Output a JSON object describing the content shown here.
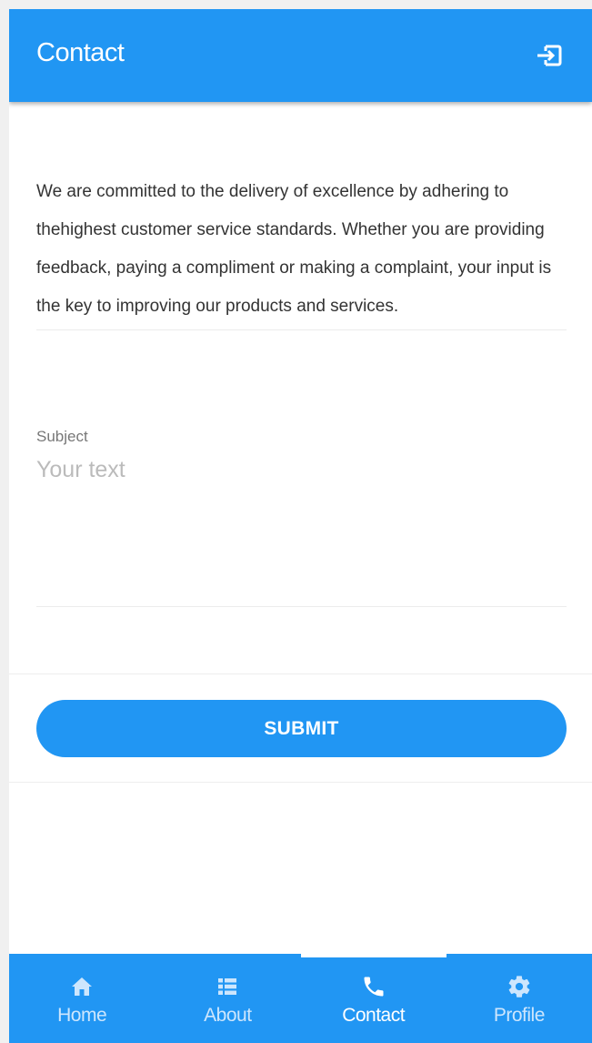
{
  "app_bar": {
    "title": "Contact",
    "action_icon": "logout-icon"
  },
  "intro": {
    "text": "We are committed to the delivery of excellence by adhering to thehighest customer service standards. Whether you are providing feedback, paying a compliment or making a complaint, your input is the key to improving our products and services."
  },
  "form": {
    "subject_label": "Subject",
    "subject_placeholder": "Your text",
    "subject_value": "",
    "submit_label": "SUBMIT"
  },
  "bottom_nav": {
    "items": [
      {
        "label": "Home",
        "icon": "home-icon",
        "active": false
      },
      {
        "label": "About",
        "icon": "list-icon",
        "active": false
      },
      {
        "label": "Contact",
        "icon": "phone-icon",
        "active": true
      },
      {
        "label": "Profile",
        "icon": "gear-icon",
        "active": false
      }
    ]
  },
  "colors": {
    "primary": "#2196f3",
    "nav_inactive_text": "#cde6fd",
    "active_text": "#ffffff",
    "body_text": "#333333"
  }
}
